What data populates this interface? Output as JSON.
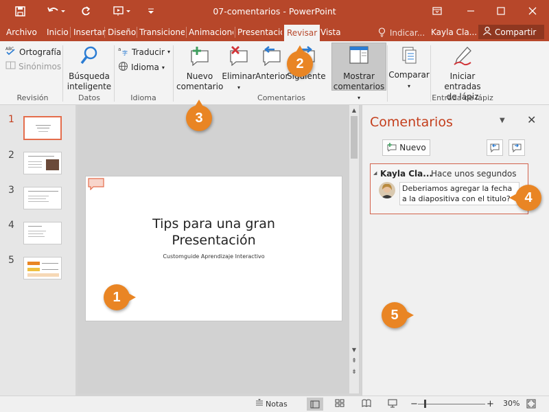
{
  "window": {
    "title": "07-comentarios  -  PowerPoint",
    "colors": {
      "accent": "#b7472a",
      "comment_title": "#c43e1c",
      "callout": "#e98524"
    }
  },
  "tabs": [
    {
      "label": "Archivo"
    },
    {
      "label": "Inicio"
    },
    {
      "label": "Insertar"
    },
    {
      "label": "Diseño"
    },
    {
      "label": "Transiciones"
    },
    {
      "label": "Animaciones"
    },
    {
      "label": "Presentación"
    },
    {
      "label": "Revisar",
      "active": true
    },
    {
      "label": "Vista"
    }
  ],
  "tellme": "Indicar...",
  "user": "Kayla Cla...",
  "share": "Compartir",
  "ribbon": {
    "revision": {
      "spelling": "Ortografía",
      "synonyms": "Sinónimos",
      "label": "Revisión"
    },
    "datos": {
      "smart_lookup_line1": "Búsqueda",
      "smart_lookup_line2": "inteligente",
      "label": "Datos"
    },
    "idioma": {
      "translate": "Traducir",
      "language": "Idioma",
      "label": "Idioma"
    },
    "comentarios": {
      "new_line1": "Nuevo",
      "new_line2": "comentario",
      "delete": "Eliminar",
      "previous": "Anterior",
      "next": "Siguiente",
      "show_line1": "Mostrar",
      "show_line2": "comentarios",
      "label": "Comentarios"
    },
    "compare": {
      "label_btn": "Comparar"
    },
    "ink": {
      "start_line1": "Iniciar entradas",
      "start_line2": "de lápiz",
      "label": "Entrada de lápiz"
    }
  },
  "slides": [
    {
      "number": "1",
      "selected": true
    },
    {
      "number": "2"
    },
    {
      "number": "3"
    },
    {
      "number": "4"
    },
    {
      "number": "5"
    }
  ],
  "slide": {
    "title_line1": "Tips para una gran",
    "title_line2": "Presentación",
    "subtitle": "Customguide Aprendizaje Interactivo"
  },
  "comments_pane": {
    "title": "Comentarios",
    "new_button": "Nuevo",
    "comment": {
      "author": "Kayla Cla...",
      "time": "Hace unos segundos",
      "text": "Deberiamos agregar la fecha a la diapositiva con el titulo?"
    }
  },
  "status": {
    "notes": "Notas",
    "zoom": "30%"
  },
  "callouts": [
    "1",
    "2",
    "3",
    "4",
    "5"
  ]
}
